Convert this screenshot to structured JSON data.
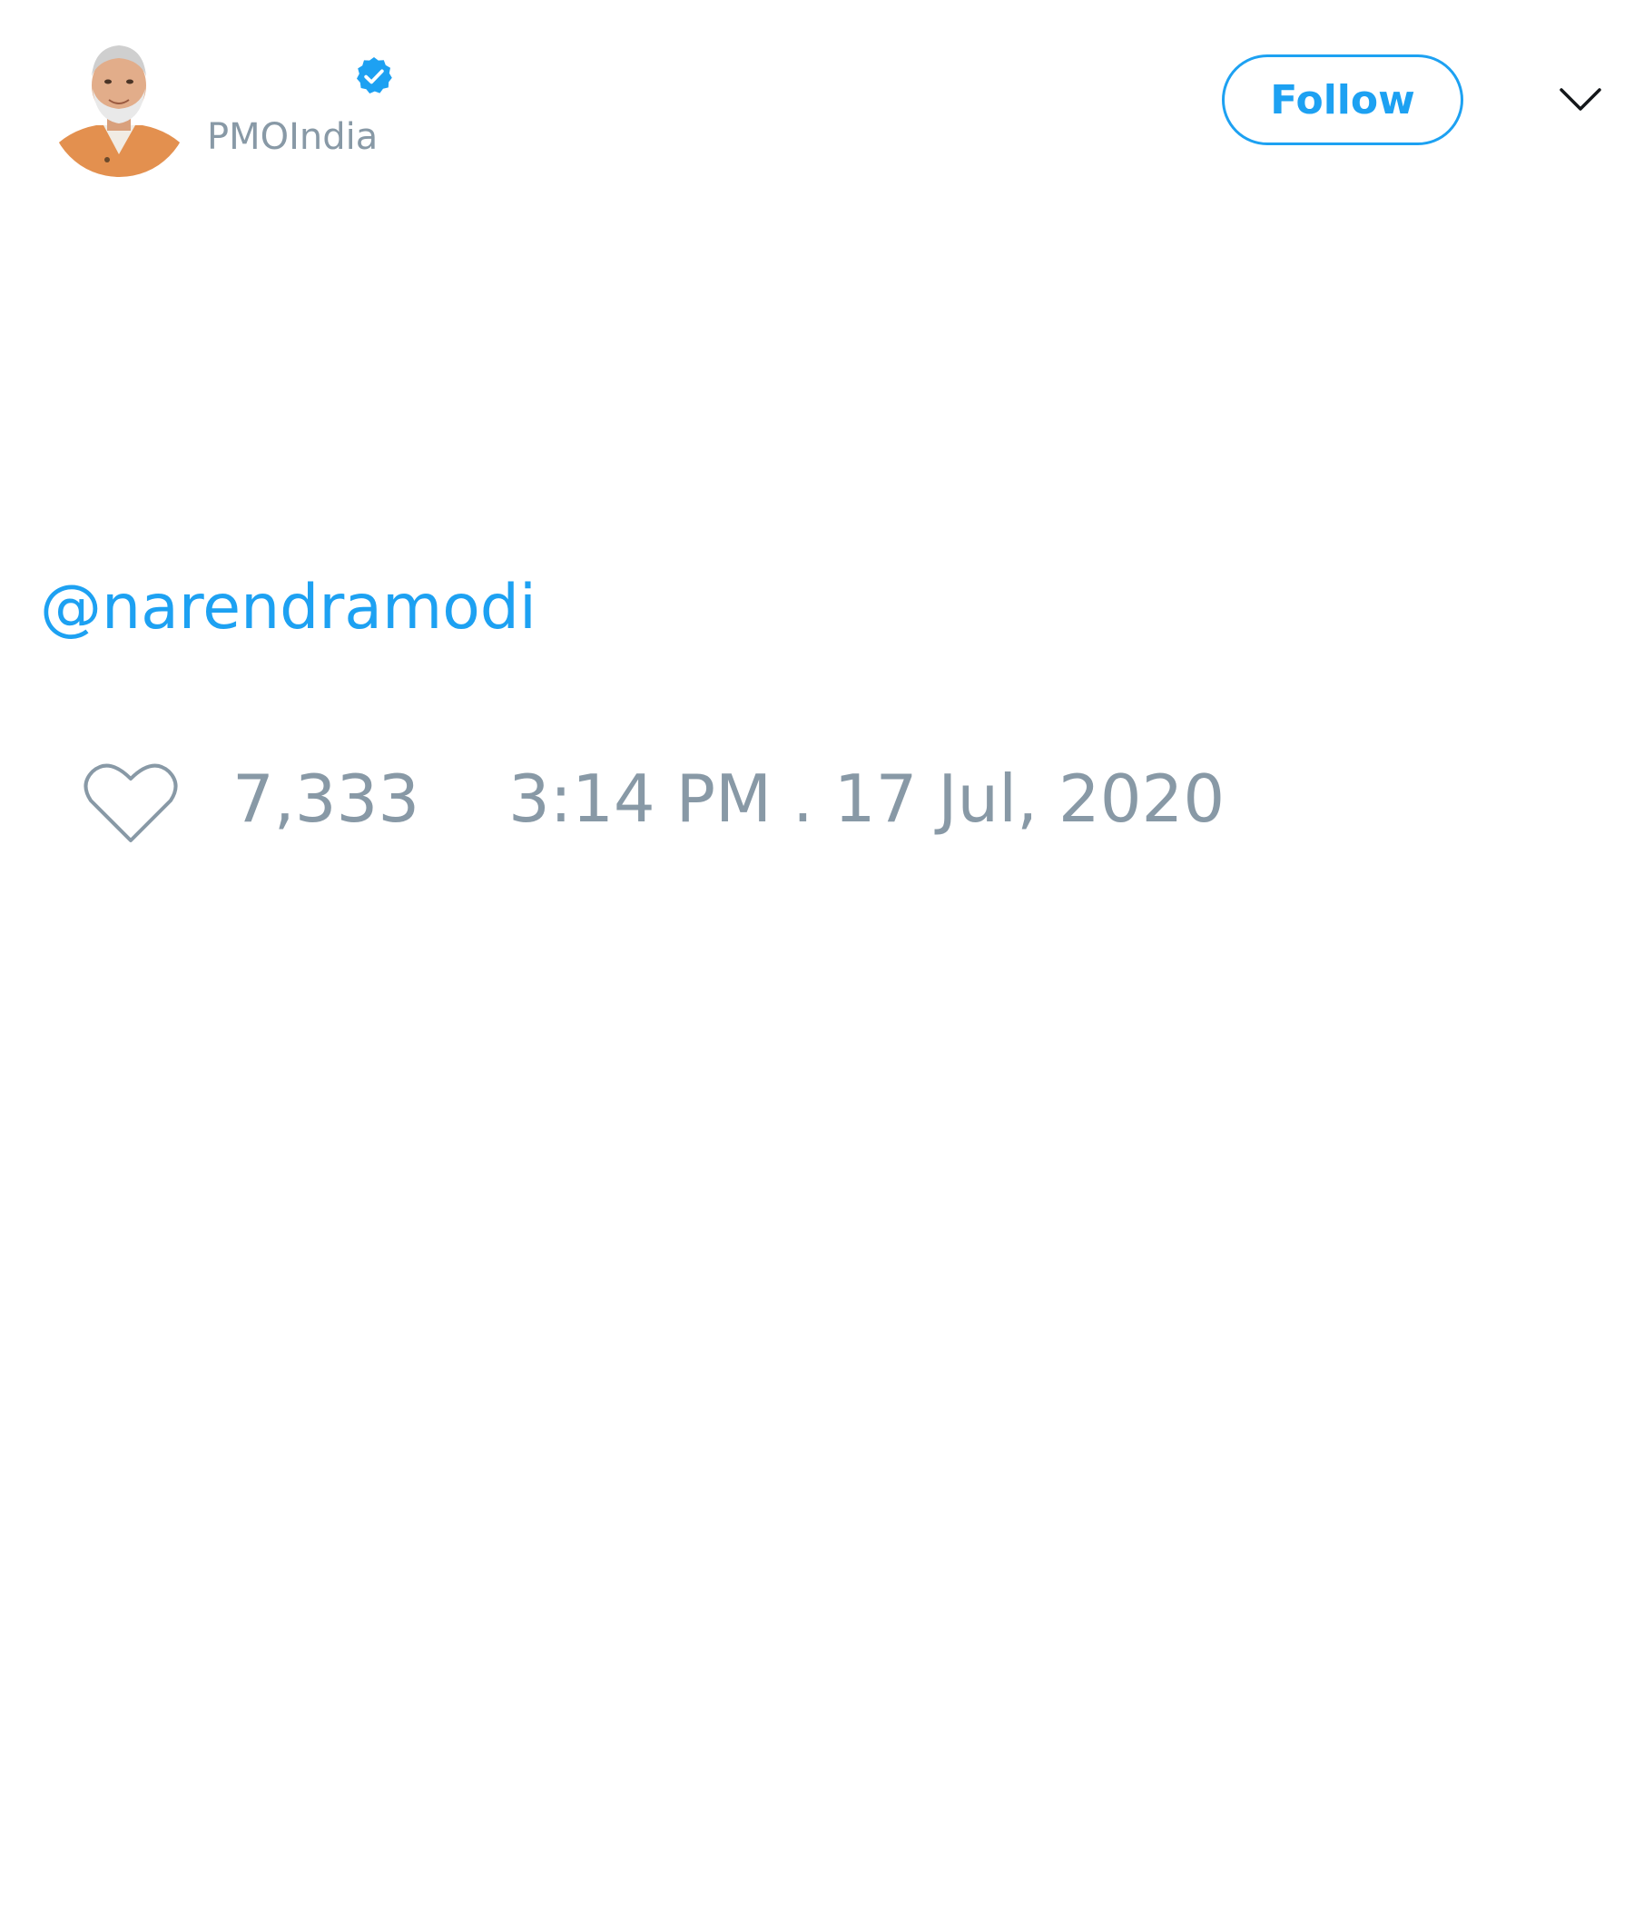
{
  "header": {
    "handle": "PMOIndia",
    "verified": true,
    "follow_label": "Follow",
    "menu_icon": "chevron-down-icon"
  },
  "tweet": {
    "mention": "@narendramodi"
  },
  "footer": {
    "like_icon": "heart-icon",
    "like_count": "7,333",
    "timestamp": "3:14 PM . 17 Jul, 2020"
  },
  "colors": {
    "accent": "#1da1f2",
    "muted": "#8899a6",
    "background": "#ffffff"
  }
}
